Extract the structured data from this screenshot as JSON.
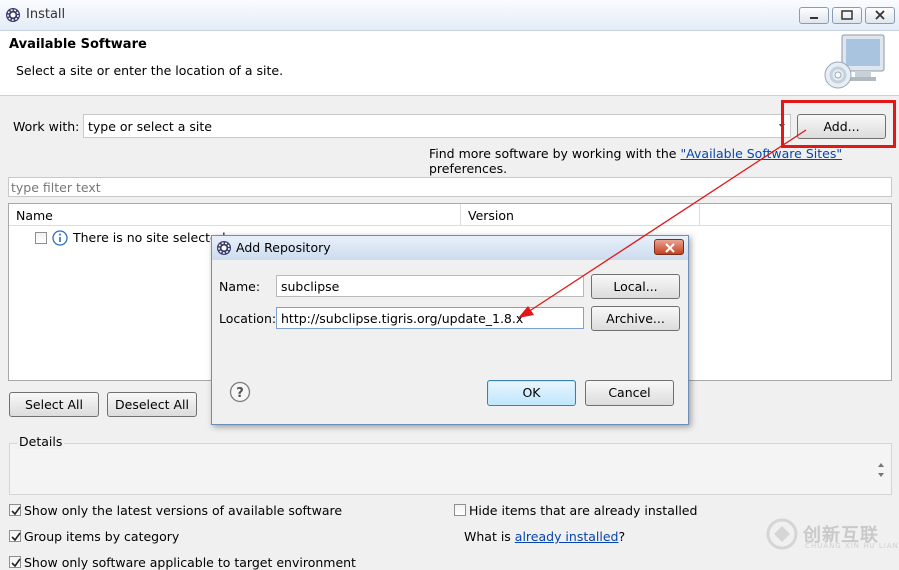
{
  "window": {
    "title": "Install"
  },
  "banner": {
    "title": "Available Software",
    "description": "Select a site or enter the location of a site."
  },
  "work_with": {
    "label": "Work with:",
    "value": "type or select a site",
    "add_label": "Add...",
    "find_more_prefix": "Find more software by working with the ",
    "find_more_link": "\"Available Software Sites\"",
    "find_more_suffix": " preferences."
  },
  "filter": {
    "placeholder": "type filter text"
  },
  "table": {
    "columns": [
      "Name",
      "Version"
    ],
    "rows": [
      {
        "text": "There is no site selected."
      }
    ]
  },
  "buttons": {
    "select_all": "Select All",
    "deselect_all": "Deselect All"
  },
  "details": {
    "label": "Details"
  },
  "options": {
    "show_latest": "Show only the latest versions of available software",
    "group_by_category": "Group items by category",
    "show_applicable": "Show only software applicable to target environment",
    "hide_installed": "Hide items that are already installed",
    "what_is_prefix": "What is ",
    "what_is_link": "already installed",
    "what_is_suffix": "?"
  },
  "dialog": {
    "title": "Add Repository",
    "name_label": "Name:",
    "name_value": "subclipse",
    "location_label": "Location:",
    "location_value": "http://subclipse.tigris.org/update_1.8.x",
    "local_label": "Local...",
    "archive_label": "Archive...",
    "ok_label": "OK",
    "cancel_label": "Cancel"
  },
  "watermark": {
    "text": "创新互联",
    "sub": "CHUANG XIN HU LIAN"
  },
  "colors": {
    "highlight": "#e01818",
    "link": "#0645ad"
  }
}
